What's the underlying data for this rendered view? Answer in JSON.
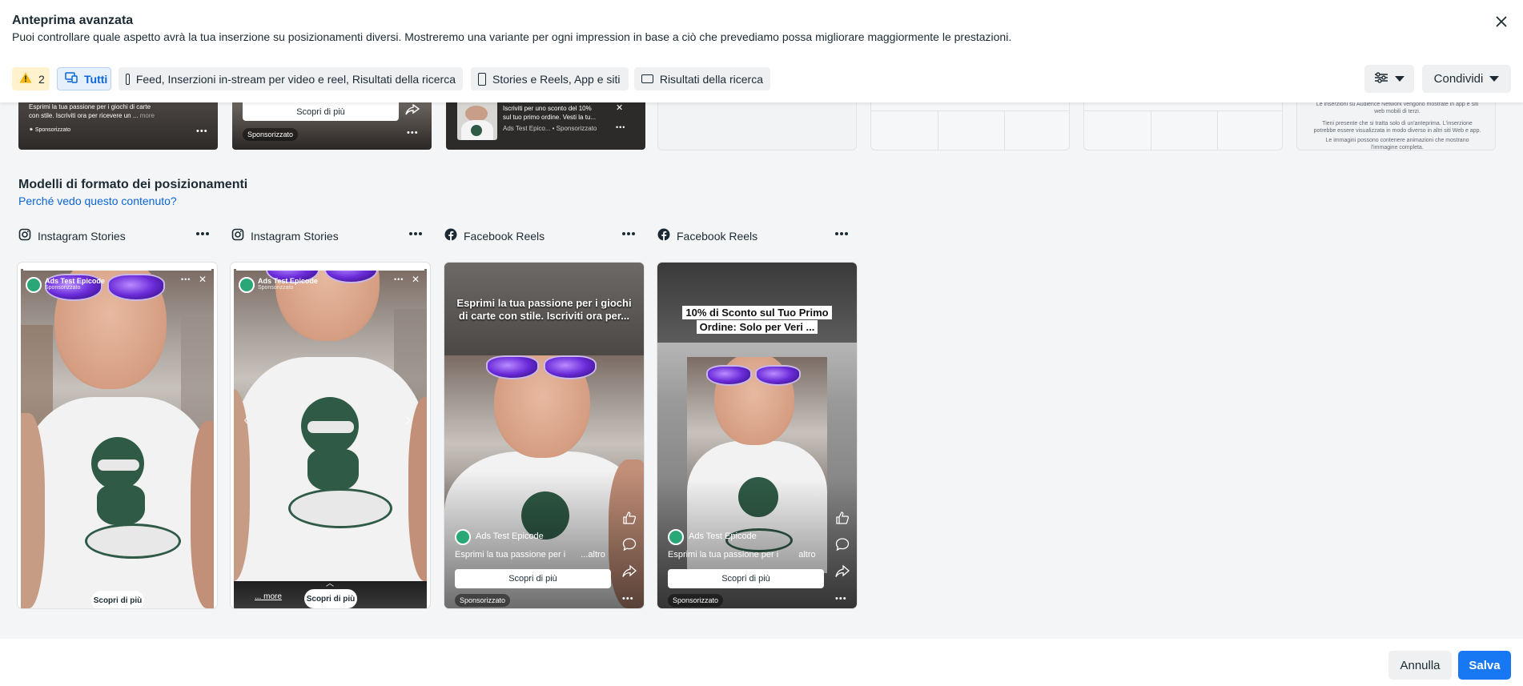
{
  "header": {
    "title": "Anteprima avanzata",
    "subtitle": "Puoi controllare quale aspetto avrà la tua inserzione su posizionamenti diversi. Mostreremo una variante per ogni impression in base a ciò che prevediamo possa migliorare maggiormente le prestazioni."
  },
  "filters": {
    "warning_count": "2",
    "all_label": "Tutti",
    "feed_label": "Feed, Inserzioni in-stream per video e reel, Risultati della ricerca",
    "stories_label": "Stories e Reels, App e siti",
    "search_label": "Risultati della ricerca",
    "share_label": "Condividi"
  },
  "top_strip": {
    "card1_text_line1": "Esprimi la tua passione per i giochi di carte",
    "card1_text_line2": "con stile. Iscriviti ora per ricevere un ...",
    "card1_more": "more",
    "card1_sponsored": "Sponsorizzato",
    "card2_cta": "Scopri di più",
    "card2_sponsored": "Sponsorizzato",
    "card3_line1": "Iscriviti per uno sconto del 10%",
    "card3_line2": "sul tuo primo ordine. Vesti la tu...",
    "card3_meta": "Ads Test Epicο... • Sponsorizzato",
    "card7_line1": "Le inserzioni su Audience Network vengono mostrate in app e siti web mobili di terzi.",
    "card7_line2": "Tieni presente che si tratta solo di un'anteprima. L'inserzione potrebbe essere visualizzata in modo diverso in altri siti Web e app.",
    "card7_line3": "Le immagini possono contenere animazioni che mostrano l'immagine completa."
  },
  "section": {
    "title": "Modelli di formato dei posizionamenti",
    "why_link": "Perché vedo questo contenuto?"
  },
  "placements": [
    {
      "label": "Instagram Stories",
      "icon": "instagram-icon"
    },
    {
      "label": "Instagram Stories",
      "icon": "instagram-icon"
    },
    {
      "label": "Facebook Reels",
      "icon": "facebook-icon"
    },
    {
      "label": "Facebook Reels",
      "icon": "facebook-icon"
    }
  ],
  "previews": {
    "page_name": "Ads Test Epicode",
    "sponsored": "Sponsorizzato",
    "story_cta": "Scopri di più",
    "story2_more": "... more",
    "reel1_caption": "Esprimi la tua passione per i giochi di carte con stile. Iscriviti ora per...",
    "reel2_caption": "10% di Sconto sul Tuo Primo Ordine: Solo per Veri ...",
    "reel_body": "Esprimi la tua passione per i",
    "reel_more": "...altro",
    "reel2_more": "altro",
    "reel_cta": "Scopri di più"
  },
  "footer": {
    "cancel": "Annulla",
    "save": "Salva"
  },
  "colors": {
    "accent": "#1877f2",
    "link": "#0a66d8",
    "warning_bg": "#fff2cc"
  }
}
